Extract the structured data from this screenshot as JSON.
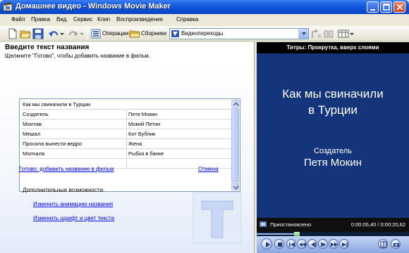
{
  "window": {
    "title": "Домашнее видео - Windows Movie Maker"
  },
  "menu": {
    "items": [
      "Файл",
      "Правка",
      "Вид",
      "Сервис",
      "Клип",
      "Воспроизведение",
      "Справка"
    ]
  },
  "toolbar": {
    "operations_label": "Операции",
    "collections_label": "Сборники",
    "collection_select": "Видеопереходы"
  },
  "title_editor": {
    "heading": "Введите текст названия",
    "hint": "Щелкните \"Готово\", чтобы добавить название в фильм.",
    "first_line": "Как мы свиначили в Турции",
    "rows": [
      {
        "left": "Создатель",
        "right": "Петя Мокин"
      },
      {
        "left": "Монтаж",
        "right": "Мокий Петин"
      },
      {
        "left": "Мешал",
        "right": "Кот Бублик"
      },
      {
        "left": "Просила вынести ведро",
        "right": "Жена"
      },
      {
        "left": "Молчала",
        "right": "Рыбка в банке"
      },
      {
        "left": "",
        "right": ""
      }
    ],
    "done_link": "Готово, добавить название в фильм",
    "cancel_link": "Отмена",
    "more_options_label": "Дополнительные возможности:",
    "change_animation_link": "Изменить анимацию названия",
    "change_font_link": "Изменить шрифт и цвет текста"
  },
  "preview": {
    "header": "Титры: Прокрутка, вверх слоями",
    "title_line1": "Как мы свиначили",
    "title_line2": "в Турции",
    "credit_role": "Создатель",
    "credit_name": "Петя Мокин",
    "status": "Приостановлено",
    "time": "0:00:05,40 / 0:00:20,62",
    "progress": 0.262
  },
  "colors": {
    "preview_bg": "#14357b",
    "titlebar": "#0a4fd6",
    "link": "#0000ee"
  }
}
